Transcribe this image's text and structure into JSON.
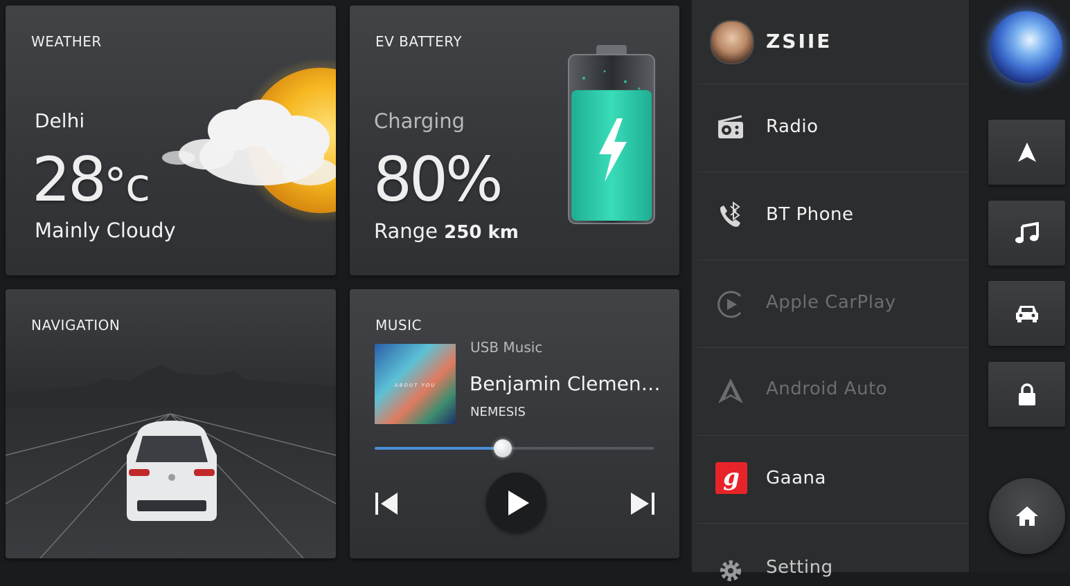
{
  "weather": {
    "title": "WEATHER",
    "city": "Delhi",
    "temperature": "28",
    "unit": "°c",
    "condition": "Mainly Cloudy"
  },
  "battery": {
    "title": "EV  BATTERY",
    "status": "Charging",
    "percent": "80%",
    "range_label": "Range",
    "range_value": "250 km",
    "level": 0.8,
    "accent": "#2fd4b0"
  },
  "navigation": {
    "title": "NAVIGATION"
  },
  "music": {
    "title": "MUSIC",
    "source": "USB  Music",
    "track": "Benjamin Clemen…",
    "artist": "NEMESIS",
    "album_text": "ABOUT YOU",
    "progress": 0.46,
    "accent": "#4a8fd8"
  },
  "sidebar": {
    "profile_name": "ZSIIE",
    "items": [
      {
        "label": "Radio",
        "icon": "radio-icon",
        "enabled": true
      },
      {
        "label": "BT Phone",
        "icon": "bluetooth-phone-icon",
        "enabled": true
      },
      {
        "label": "Apple CarPlay",
        "icon": "carplay-icon",
        "enabled": false
      },
      {
        "label": "Android Auto",
        "icon": "android-auto-icon",
        "enabled": false
      },
      {
        "label": "Gaana",
        "icon": "gaana-icon",
        "enabled": true
      },
      {
        "label": "Setting",
        "icon": "gear-icon",
        "enabled": true
      }
    ],
    "gaana_color": "#e72429"
  },
  "rail": {
    "buttons": [
      "navigation-arrow-icon",
      "music-note-icon",
      "car-icon",
      "lock-icon"
    ],
    "home": "home-icon",
    "assistant": "voice-assistant-orb"
  }
}
